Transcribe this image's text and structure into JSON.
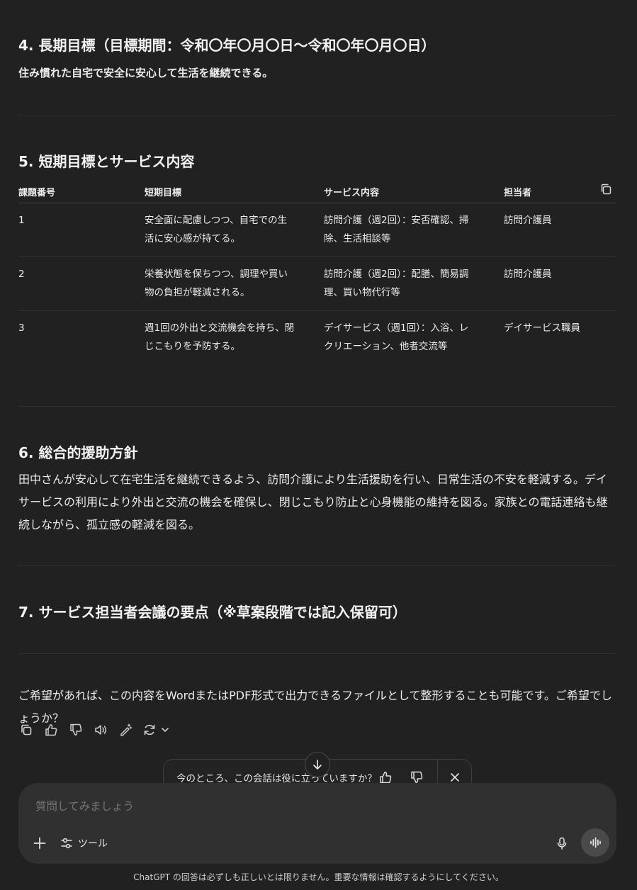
{
  "section4": {
    "heading": "4. 長期目標（目標期間：令和〇年〇月〇日〜令和〇年〇月〇日）",
    "text": "住み慣れた自宅で安全に安心して生活を継続できる。"
  },
  "section5": {
    "heading": "5. 短期目標とサービス内容",
    "columns": [
      "課題番号",
      "短期目標",
      "サービス内容",
      "担当者"
    ],
    "rows": [
      {
        "no": "1",
        "goal": "安全面に配慮しつつ、自宅での生活に安心感が持てる。",
        "service": "訪問介護（週2回）：安否確認、掃除、生活相談等",
        "staff": "訪問介護員"
      },
      {
        "no": "2",
        "goal": "栄養状態を保ちつつ、調理や買い物の負担が軽減される。",
        "service": "訪問介護（週2回）：配膳、簡易調理、買い物代行等",
        "staff": "訪問介護員"
      },
      {
        "no": "3",
        "goal": "週1回の外出と交流機会を持ち、閉じこもりを予防する。",
        "service": "デイサービス（週1回）：入浴、レクリエーション、他者交流等",
        "staff": "デイサービス職員"
      }
    ]
  },
  "section6": {
    "heading": "6. 総合的援助方針",
    "text": "田中さんが安心して在宅生活を継続できるよう、訪問介護により生活援助を行い、日常生活の不安を軽減する。デイサービスの利用により外出と交流の機会を確保し、閉じこもり防止と心身機能の維持を図る。家族との電話連絡も継続しながら、孤立感の軽減を図る。"
  },
  "section7": {
    "heading": "7. サービス担当者会議の要点（※草案段階では記入保留可）"
  },
  "closing": "ご希望があれば、この内容をWordまたはPDF形式で出力できるファイルとして整形することも可能です。ご希望でしょうか？",
  "feedback": {
    "question": "今のところ、この会話は役に立っていますか？"
  },
  "composer": {
    "placeholder": "質問してみましょう",
    "tools_label": "ツール"
  },
  "disclaimer": "ChatGPT の回答は必ずしも正しいとは限りません。重要な情報は確認するようにしてください。"
}
